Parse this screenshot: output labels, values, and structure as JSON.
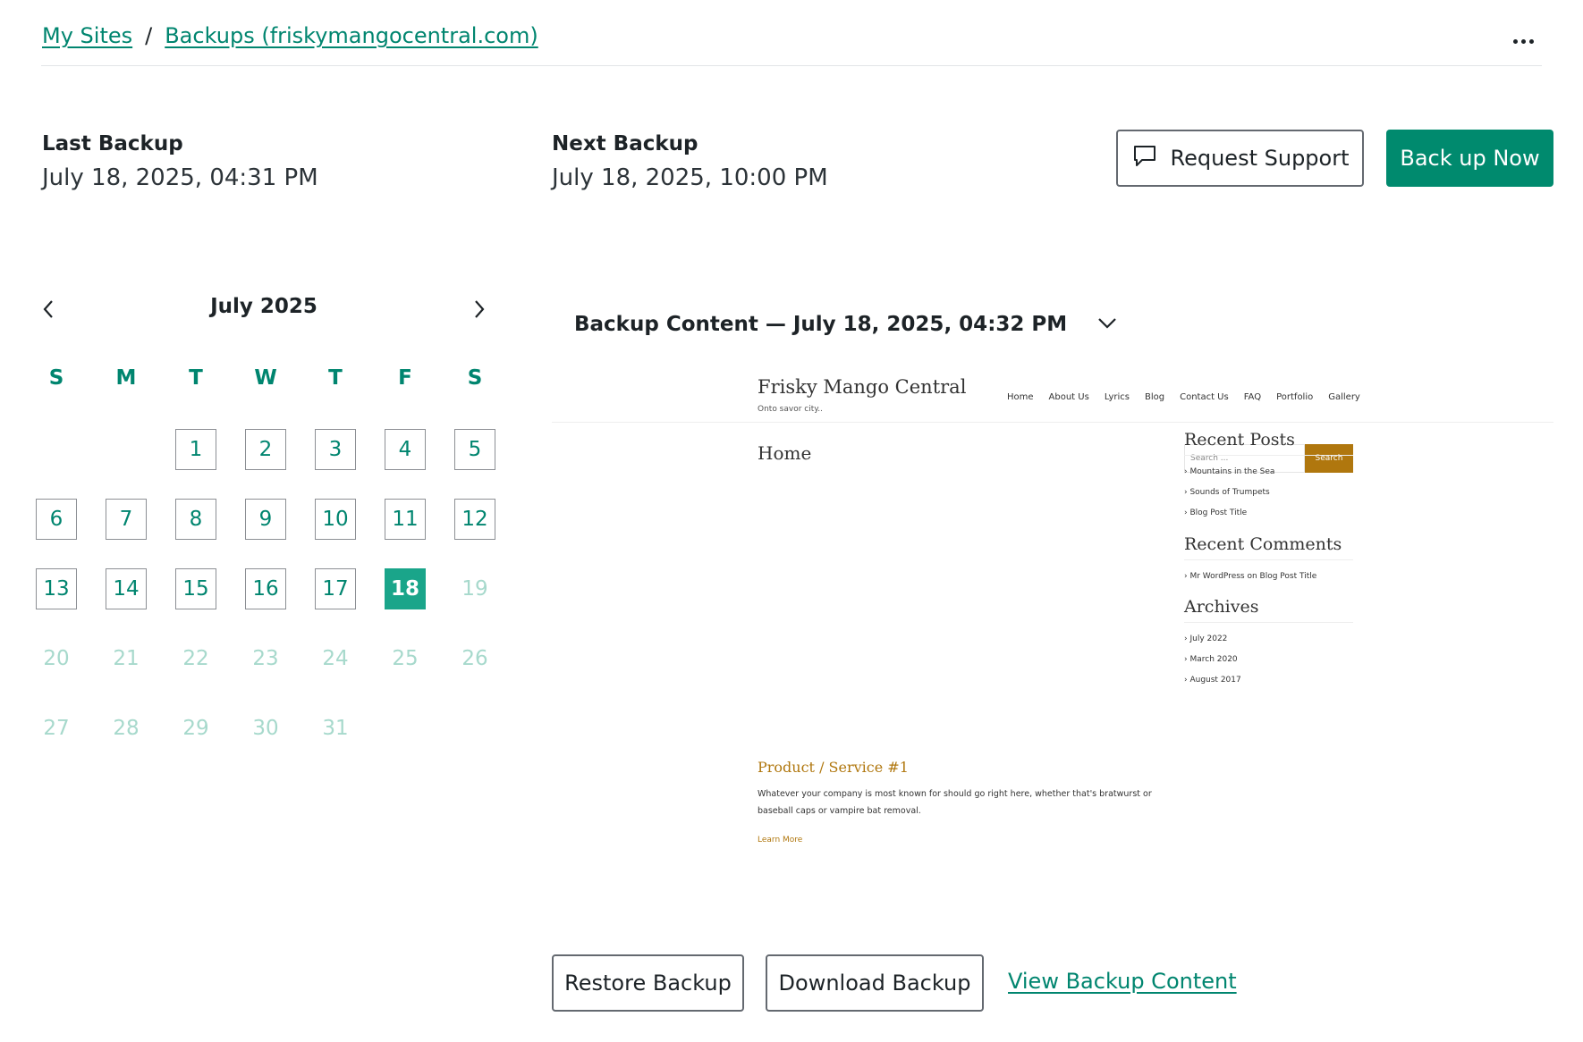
{
  "breadcrumb": {
    "items": [
      {
        "label": "My Sites"
      },
      {
        "label": "Backups (friskymangocentral.com)"
      }
    ],
    "separator": "/"
  },
  "header": {
    "more_icon": "ellipsis-icon"
  },
  "backup_info": {
    "last_label": "Last Backup",
    "last_value": "July 18, 2025, 04:31 PM",
    "next_label": "Next Backup",
    "next_value": "July 18, 2025, 10:00 PM"
  },
  "actions": {
    "support_label": "Request Support",
    "support_icon": "chat-bubble-icon",
    "backup_now_label": "Back up Now"
  },
  "calendar": {
    "month_label": "July 2025",
    "weekdays": [
      "S",
      "M",
      "T",
      "W",
      "T",
      "F",
      "S"
    ],
    "leading_blanks": 2,
    "days": [
      {
        "n": "1",
        "state": "active"
      },
      {
        "n": "2",
        "state": "active"
      },
      {
        "n": "3",
        "state": "active"
      },
      {
        "n": "4",
        "state": "active"
      },
      {
        "n": "5",
        "state": "active"
      },
      {
        "n": "6",
        "state": "active"
      },
      {
        "n": "7",
        "state": "active"
      },
      {
        "n": "8",
        "state": "active"
      },
      {
        "n": "9",
        "state": "active"
      },
      {
        "n": "10",
        "state": "active"
      },
      {
        "n": "11",
        "state": "active"
      },
      {
        "n": "12",
        "state": "active"
      },
      {
        "n": "13",
        "state": "active"
      },
      {
        "n": "14",
        "state": "active"
      },
      {
        "n": "15",
        "state": "active"
      },
      {
        "n": "16",
        "state": "active"
      },
      {
        "n": "17",
        "state": "active"
      },
      {
        "n": "18",
        "state": "selected"
      },
      {
        "n": "19",
        "state": "disabled"
      },
      {
        "n": "20",
        "state": "disabled"
      },
      {
        "n": "21",
        "state": "disabled"
      },
      {
        "n": "22",
        "state": "disabled"
      },
      {
        "n": "23",
        "state": "disabled"
      },
      {
        "n": "24",
        "state": "disabled"
      },
      {
        "n": "25",
        "state": "disabled"
      },
      {
        "n": "26",
        "state": "disabled"
      },
      {
        "n": "27",
        "state": "disabled"
      },
      {
        "n": "28",
        "state": "disabled"
      },
      {
        "n": "29",
        "state": "disabled"
      },
      {
        "n": "30",
        "state": "disabled"
      },
      {
        "n": "31",
        "state": "disabled"
      }
    ]
  },
  "content": {
    "title": "Backup Content — July 18, 2025, 04:32 PM"
  },
  "preview": {
    "site_name": "Frisky Mango Central",
    "tagline": "Onto savor city..",
    "nav": [
      "Home",
      "About Us",
      "Lyrics",
      "Blog",
      "Contact Us",
      "FAQ",
      "Portfolio",
      "Gallery"
    ],
    "page_title": "Home",
    "search_placeholder": "Search ...",
    "search_button": "Search",
    "widgets": [
      {
        "title": "Recent Posts",
        "items": [
          "› Mountains in the Sea",
          "› Sounds of Trumpets",
          "› Blog Post Title"
        ]
      },
      {
        "title": "Recent Comments",
        "items": [
          "› Mr WordPress on Blog Post Title"
        ]
      },
      {
        "title": "Archives",
        "items": [
          "› July 2022",
          "› March 2020",
          "› August 2017"
        ]
      }
    ],
    "product_title": "Product / Service #1",
    "product_text": "Whatever your company is most known for should go right here, whether that's bratwurst or baseball caps or vampire bat removal.",
    "learn_more": "Learn More"
  },
  "bottom": {
    "restore_label": "Restore Backup",
    "download_label": "Download Backup",
    "view_label": "View Backup Content"
  },
  "colors": {
    "accent": "#008a6e",
    "link": "#00856f",
    "selected_day": "#1aa58a",
    "disabled_day": "#a7d9cc",
    "preview_accent": "#b0770e"
  }
}
